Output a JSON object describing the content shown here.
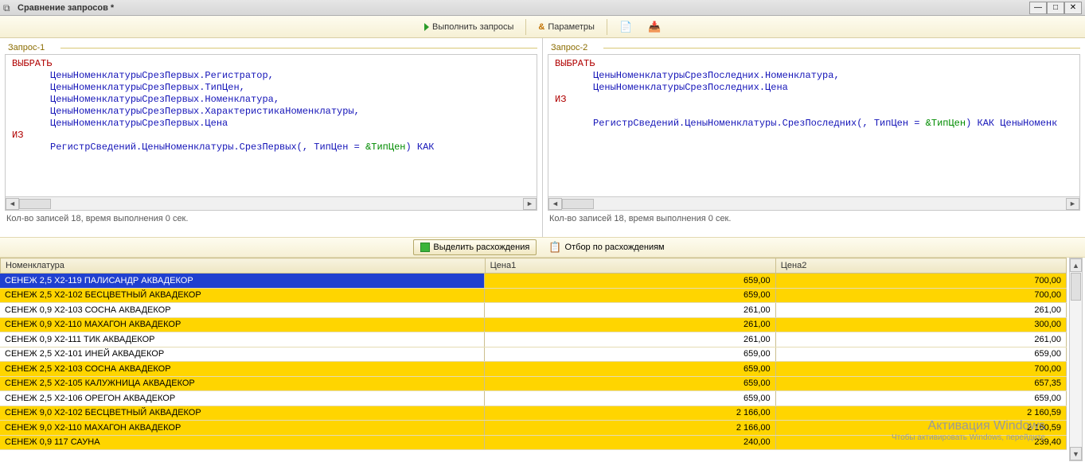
{
  "window": {
    "title": "Сравнение запросов *"
  },
  "toolbar": {
    "run_label": "Выполнить запросы",
    "params_label": "Параметры"
  },
  "panes": {
    "q1": {
      "legend": "Запрос-1",
      "status": "Кол-во записей 18, время выполнения 0 сек."
    },
    "q2": {
      "legend": "Запрос-2",
      "status": "Кол-во записей 18, время выполнения 0 сек."
    }
  },
  "code1": {
    "kw_select": "ВЫБРАТЬ",
    "l1": "ЦеныНоменклатурыСрезПервых.Регистратор,",
    "l2": "ЦеныНоменклатурыСрезПервых.ТипЦен,",
    "l3": "ЦеныНоменклатурыСрезПервых.Номенклатура,",
    "l4": "ЦеныНоменклатурыСрезПервых.ХарактеристикаНоменклатуры,",
    "l5": "ЦеныНоменклатурыСрезПервых.Цена",
    "kw_from": "ИЗ",
    "from_a": "РегистрСведений.ЦеныНоменклатуры.СрезПервых(, ТипЦен = ",
    "from_p": "&ТипЦен",
    "from_b": ") КАК "
  },
  "code2": {
    "kw_select": "ВЫБРАТЬ",
    "l1": "ЦеныНоменклатурыСрезПоследних.Номенклатура,",
    "l2": "ЦеныНоменклатурыСрезПоследних.Цена",
    "kw_from": "ИЗ",
    "from_a": "РегистрСведений.ЦеныНоменклатуры.СрезПоследних(, ТипЦен = ",
    "from_p": "&ТипЦен",
    "from_b": ") КАК ЦеныНоменк"
  },
  "midbar": {
    "highlight_label": "Выделить расхождения",
    "filter_label": "Отбор по расхождениям"
  },
  "columns": {
    "c0": "Номенклатура",
    "c1": "Цена1",
    "c2": "Цена2"
  },
  "rows": [
    {
      "n": "СЕНЕЖ 2,5 Х2-119  ПАЛИСАНДР АКВАДЕКОР",
      "p1": "659,00",
      "p2": "700,00",
      "diff": true,
      "sel": true
    },
    {
      "n": "СЕНЕЖ 2,5 Х2-102 БЕСЦВЕТНЫЙ АКВАДЕКОР",
      "p1": "659,00",
      "p2": "700,00",
      "diff": true
    },
    {
      "n": "СЕНЕЖ 0,9 Х2-103 СОСНА АКВАДЕКОР",
      "p1": "261,00",
      "p2": "261,00",
      "diff": false
    },
    {
      "n": "СЕНЕЖ 0,9 Х2-110 МАХАГОН АКВАДЕКОР",
      "p1": "261,00",
      "p2": "300,00",
      "diff": true
    },
    {
      "n": "СЕНЕЖ 0,9 Х2-111 ТИК АКВАДЕКОР",
      "p1": "261,00",
      "p2": "261,00",
      "diff": false
    },
    {
      "n": "СЕНЕЖ 2,5 Х2-101 ИНЕЙ АКВАДЕКОР",
      "p1": "659,00",
      "p2": "659,00",
      "diff": false
    },
    {
      "n": "СЕНЕЖ 2,5 Х2-103 СОСНА  АКВАДЕКОР",
      "p1": "659,00",
      "p2": "700,00",
      "diff": true
    },
    {
      "n": "СЕНЕЖ 2,5 Х2-105 КАЛУЖНИЦА АКВАДЕКОР",
      "p1": "659,00",
      "p2": "657,35",
      "diff": true
    },
    {
      "n": "СЕНЕЖ 2,5 Х2-106 ОРЕГОН АКВАДЕКОР",
      "p1": "659,00",
      "p2": "659,00",
      "diff": false
    },
    {
      "n": "СЕНЕЖ 9,0 Х2-102 БЕСЦВЕТНЫЙ АКВАДЕКОР",
      "p1": "2 166,00",
      "p2": "2 160,59",
      "diff": true
    },
    {
      "n": "СЕНЕЖ 9,0 Х2-110 МАХАГОН АКВАДЕКОР",
      "p1": "2 166,00",
      "p2": "2 160,59",
      "diff": true
    },
    {
      "n": "СЕНЕЖ 0,9 117 САУНА",
      "p1": "240,00",
      "p2": "239,40",
      "diff": true
    }
  ],
  "watermark": {
    "line1": "Активация Windows",
    "line2": "Чтобы активировать Windows, перейдите"
  }
}
